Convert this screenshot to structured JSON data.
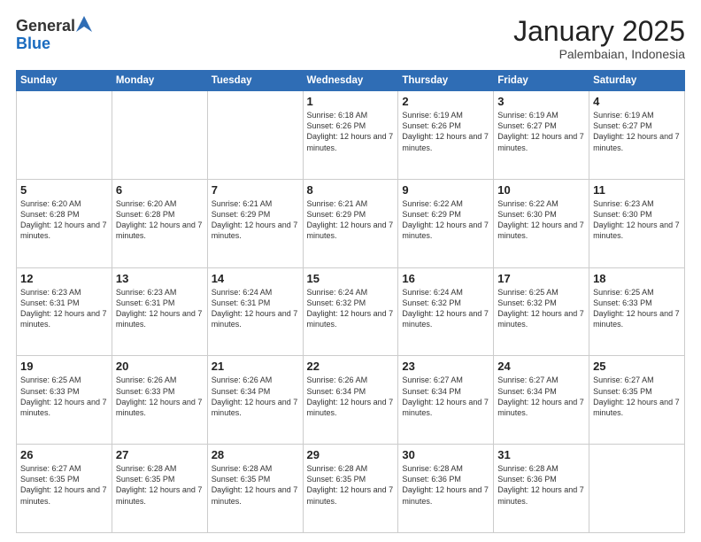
{
  "logo": {
    "general": "General",
    "blue": "Blue"
  },
  "header": {
    "title": "January 2025",
    "subtitle": "Palembaian, Indonesia"
  },
  "weekdays": [
    "Sunday",
    "Monday",
    "Tuesday",
    "Wednesday",
    "Thursday",
    "Friday",
    "Saturday"
  ],
  "weeks": [
    [
      {
        "day": "",
        "sunrise": "",
        "sunset": "",
        "daylight": "",
        "empty": true
      },
      {
        "day": "",
        "sunrise": "",
        "sunset": "",
        "daylight": "",
        "empty": true
      },
      {
        "day": "",
        "sunrise": "",
        "sunset": "",
        "daylight": "",
        "empty": true
      },
      {
        "day": "1",
        "sunrise": "Sunrise: 6:18 AM",
        "sunset": "Sunset: 6:26 PM",
        "daylight": "Daylight: 12 hours and 7 minutes.",
        "empty": false
      },
      {
        "day": "2",
        "sunrise": "Sunrise: 6:19 AM",
        "sunset": "Sunset: 6:26 PM",
        "daylight": "Daylight: 12 hours and 7 minutes.",
        "empty": false
      },
      {
        "day": "3",
        "sunrise": "Sunrise: 6:19 AM",
        "sunset": "Sunset: 6:27 PM",
        "daylight": "Daylight: 12 hours and 7 minutes.",
        "empty": false
      },
      {
        "day": "4",
        "sunrise": "Sunrise: 6:19 AM",
        "sunset": "Sunset: 6:27 PM",
        "daylight": "Daylight: 12 hours and 7 minutes.",
        "empty": false
      }
    ],
    [
      {
        "day": "5",
        "sunrise": "Sunrise: 6:20 AM",
        "sunset": "Sunset: 6:28 PM",
        "daylight": "Daylight: 12 hours and 7 minutes.",
        "empty": false
      },
      {
        "day": "6",
        "sunrise": "Sunrise: 6:20 AM",
        "sunset": "Sunset: 6:28 PM",
        "daylight": "Daylight: 12 hours and 7 minutes.",
        "empty": false
      },
      {
        "day": "7",
        "sunrise": "Sunrise: 6:21 AM",
        "sunset": "Sunset: 6:29 PM",
        "daylight": "Daylight: 12 hours and 7 minutes.",
        "empty": false
      },
      {
        "day": "8",
        "sunrise": "Sunrise: 6:21 AM",
        "sunset": "Sunset: 6:29 PM",
        "daylight": "Daylight: 12 hours and 7 minutes.",
        "empty": false
      },
      {
        "day": "9",
        "sunrise": "Sunrise: 6:22 AM",
        "sunset": "Sunset: 6:29 PM",
        "daylight": "Daylight: 12 hours and 7 minutes.",
        "empty": false
      },
      {
        "day": "10",
        "sunrise": "Sunrise: 6:22 AM",
        "sunset": "Sunset: 6:30 PM",
        "daylight": "Daylight: 12 hours and 7 minutes.",
        "empty": false
      },
      {
        "day": "11",
        "sunrise": "Sunrise: 6:23 AM",
        "sunset": "Sunset: 6:30 PM",
        "daylight": "Daylight: 12 hours and 7 minutes.",
        "empty": false
      }
    ],
    [
      {
        "day": "12",
        "sunrise": "Sunrise: 6:23 AM",
        "sunset": "Sunset: 6:31 PM",
        "daylight": "Daylight: 12 hours and 7 minutes.",
        "empty": false
      },
      {
        "day": "13",
        "sunrise": "Sunrise: 6:23 AM",
        "sunset": "Sunset: 6:31 PM",
        "daylight": "Daylight: 12 hours and 7 minutes.",
        "empty": false
      },
      {
        "day": "14",
        "sunrise": "Sunrise: 6:24 AM",
        "sunset": "Sunset: 6:31 PM",
        "daylight": "Daylight: 12 hours and 7 minutes.",
        "empty": false
      },
      {
        "day": "15",
        "sunrise": "Sunrise: 6:24 AM",
        "sunset": "Sunset: 6:32 PM",
        "daylight": "Daylight: 12 hours and 7 minutes.",
        "empty": false
      },
      {
        "day": "16",
        "sunrise": "Sunrise: 6:24 AM",
        "sunset": "Sunset: 6:32 PM",
        "daylight": "Daylight: 12 hours and 7 minutes.",
        "empty": false
      },
      {
        "day": "17",
        "sunrise": "Sunrise: 6:25 AM",
        "sunset": "Sunset: 6:32 PM",
        "daylight": "Daylight: 12 hours and 7 minutes.",
        "empty": false
      },
      {
        "day": "18",
        "sunrise": "Sunrise: 6:25 AM",
        "sunset": "Sunset: 6:33 PM",
        "daylight": "Daylight: 12 hours and 7 minutes.",
        "empty": false
      }
    ],
    [
      {
        "day": "19",
        "sunrise": "Sunrise: 6:25 AM",
        "sunset": "Sunset: 6:33 PM",
        "daylight": "Daylight: 12 hours and 7 minutes.",
        "empty": false
      },
      {
        "day": "20",
        "sunrise": "Sunrise: 6:26 AM",
        "sunset": "Sunset: 6:33 PM",
        "daylight": "Daylight: 12 hours and 7 minutes.",
        "empty": false
      },
      {
        "day": "21",
        "sunrise": "Sunrise: 6:26 AM",
        "sunset": "Sunset: 6:34 PM",
        "daylight": "Daylight: 12 hours and 7 minutes.",
        "empty": false
      },
      {
        "day": "22",
        "sunrise": "Sunrise: 6:26 AM",
        "sunset": "Sunset: 6:34 PM",
        "daylight": "Daylight: 12 hours and 7 minutes.",
        "empty": false
      },
      {
        "day": "23",
        "sunrise": "Sunrise: 6:27 AM",
        "sunset": "Sunset: 6:34 PM",
        "daylight": "Daylight: 12 hours and 7 minutes.",
        "empty": false
      },
      {
        "day": "24",
        "sunrise": "Sunrise: 6:27 AM",
        "sunset": "Sunset: 6:34 PM",
        "daylight": "Daylight: 12 hours and 7 minutes.",
        "empty": false
      },
      {
        "day": "25",
        "sunrise": "Sunrise: 6:27 AM",
        "sunset": "Sunset: 6:35 PM",
        "daylight": "Daylight: 12 hours and 7 minutes.",
        "empty": false
      }
    ],
    [
      {
        "day": "26",
        "sunrise": "Sunrise: 6:27 AM",
        "sunset": "Sunset: 6:35 PM",
        "daylight": "Daylight: 12 hours and 7 minutes.",
        "empty": false
      },
      {
        "day": "27",
        "sunrise": "Sunrise: 6:28 AM",
        "sunset": "Sunset: 6:35 PM",
        "daylight": "Daylight: 12 hours and 7 minutes.",
        "empty": false
      },
      {
        "day": "28",
        "sunrise": "Sunrise: 6:28 AM",
        "sunset": "Sunset: 6:35 PM",
        "daylight": "Daylight: 12 hours and 7 minutes.",
        "empty": false
      },
      {
        "day": "29",
        "sunrise": "Sunrise: 6:28 AM",
        "sunset": "Sunset: 6:35 PM",
        "daylight": "Daylight: 12 hours and 7 minutes.",
        "empty": false
      },
      {
        "day": "30",
        "sunrise": "Sunrise: 6:28 AM",
        "sunset": "Sunset: 6:36 PM",
        "daylight": "Daylight: 12 hours and 7 minutes.",
        "empty": false
      },
      {
        "day": "31",
        "sunrise": "Sunrise: 6:28 AM",
        "sunset": "Sunset: 6:36 PM",
        "daylight": "Daylight: 12 hours and 7 minutes.",
        "empty": false
      },
      {
        "day": "",
        "sunrise": "",
        "sunset": "",
        "daylight": "",
        "empty": true
      }
    ]
  ]
}
